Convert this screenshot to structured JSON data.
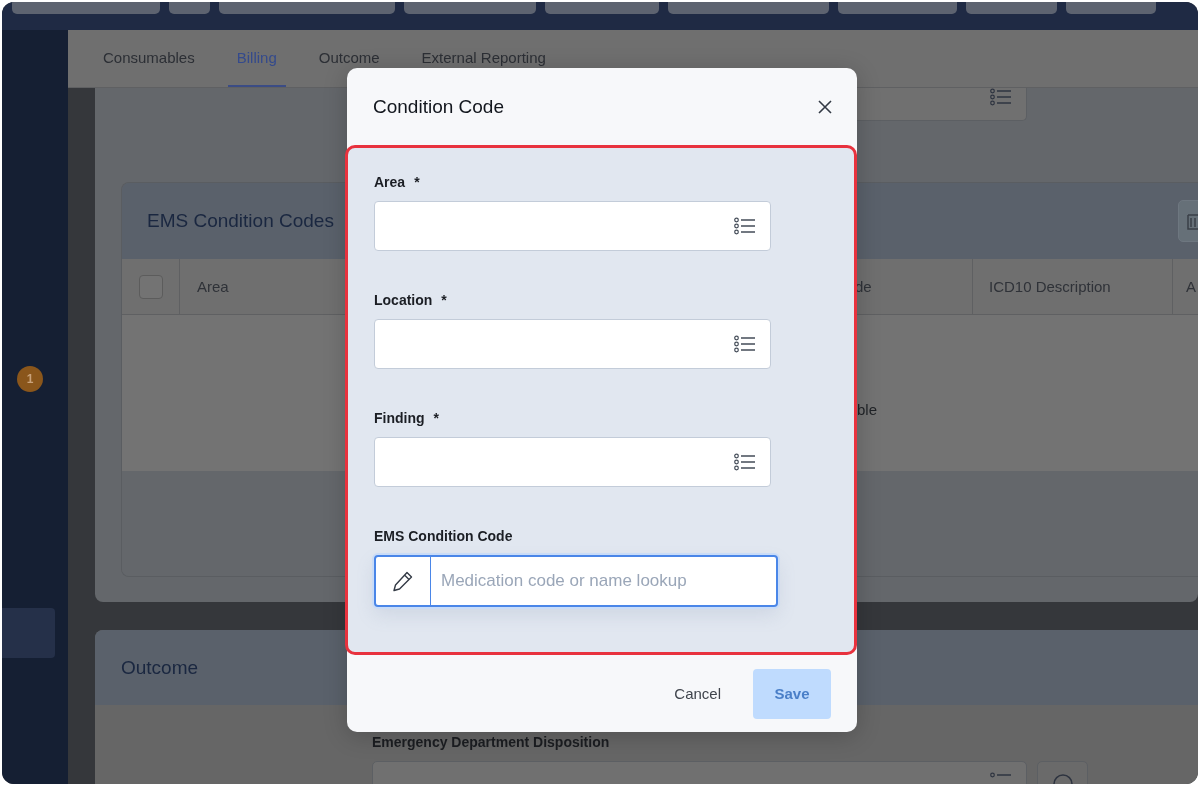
{
  "sidebar": {
    "badge": "1"
  },
  "tabs": [
    {
      "label": "Consumables",
      "selected": false
    },
    {
      "label": "Billing",
      "selected": true
    },
    {
      "label": "Outcome",
      "selected": false
    },
    {
      "label": "External Reporting",
      "selected": false
    }
  ],
  "condition_codes": {
    "title": "EMS Condition Codes",
    "select_all_checked": false,
    "columns": [
      "Area",
      "de",
      "ICD10 Description",
      "A"
    ],
    "empty_text": "ble"
  },
  "outcome": {
    "title": "Outcome",
    "field_label": "Emergency Department Disposition"
  },
  "modal": {
    "title": "Condition Code",
    "fields": [
      {
        "label": "Area",
        "required_mark": "*",
        "kind": "list"
      },
      {
        "label": "Location",
        "required_mark": "*",
        "kind": "list"
      },
      {
        "label": "Finding",
        "required_mark": "*",
        "kind": "list"
      },
      {
        "label": "EMS Condition Code",
        "kind": "lookup",
        "placeholder": "Medication code or name lookup"
      }
    ],
    "cancel": {
      "label": "Cancel"
    },
    "save": {
      "label": "Save",
      "disabled": true
    }
  }
}
